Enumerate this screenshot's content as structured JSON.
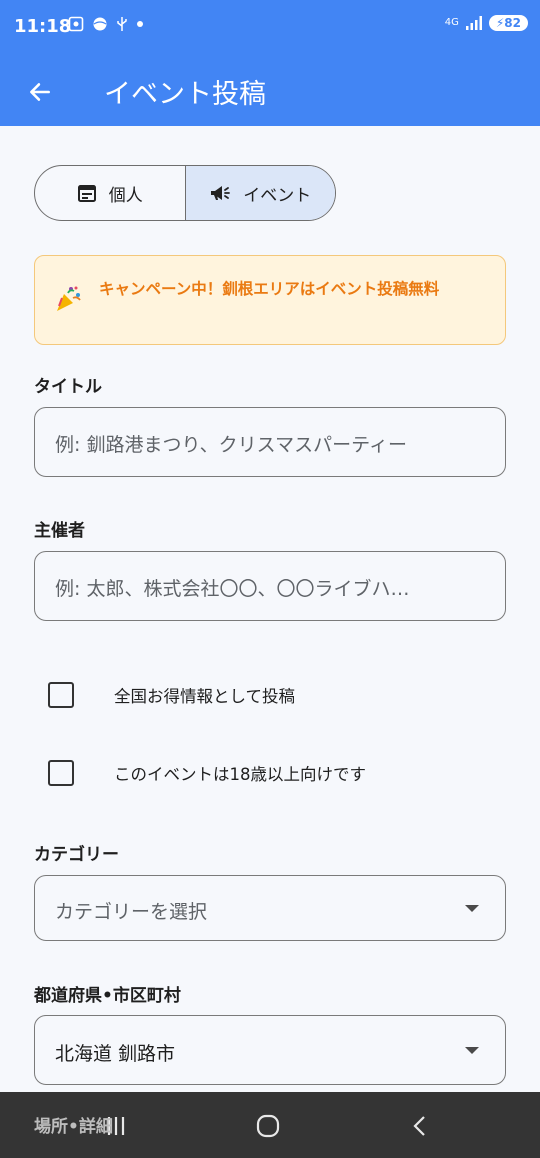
{
  "status_bar": {
    "time": "11:18",
    "network": "4G",
    "battery": "82"
  },
  "app_bar": {
    "title": "イベント投稿"
  },
  "post_type": {
    "options": [
      {
        "label": "個人",
        "icon": "calendar-icon",
        "selected": false
      },
      {
        "label": "イベント",
        "icon": "megaphone-icon",
        "selected": true
      }
    ]
  },
  "banner": {
    "icon": "party-popper-icon",
    "text": "キャンペーン中！釧根エリアはイベント投稿無料"
  },
  "form": {
    "title_label": "タイトル",
    "title_placeholder": "例: 釧路港まつり、クリスマスパーティー",
    "organizer_label": "主催者",
    "organizer_placeholder": "例: 太郎、株式会社〇〇、〇〇ライブハ…",
    "checkboxes": [
      {
        "label": "全国お得情報として投稿",
        "checked": false
      },
      {
        "label": "このイベントは18歳以上向けです",
        "checked": false
      }
    ],
    "category_label": "カテゴリー",
    "category_placeholder": "カテゴリーを選択",
    "region_label": "都道府県•市区町村",
    "region_value": "北海道 釧路市",
    "place_label": "場所•詳細"
  },
  "colors": {
    "primary": "#4285f4",
    "background": "#f6f8fc",
    "selected_segment": "#dbe6f8",
    "banner_background": "#fff4dd",
    "banner_border": "#f4c87b",
    "banner_text": "#ea7a12",
    "nav_bar": "#343434"
  }
}
